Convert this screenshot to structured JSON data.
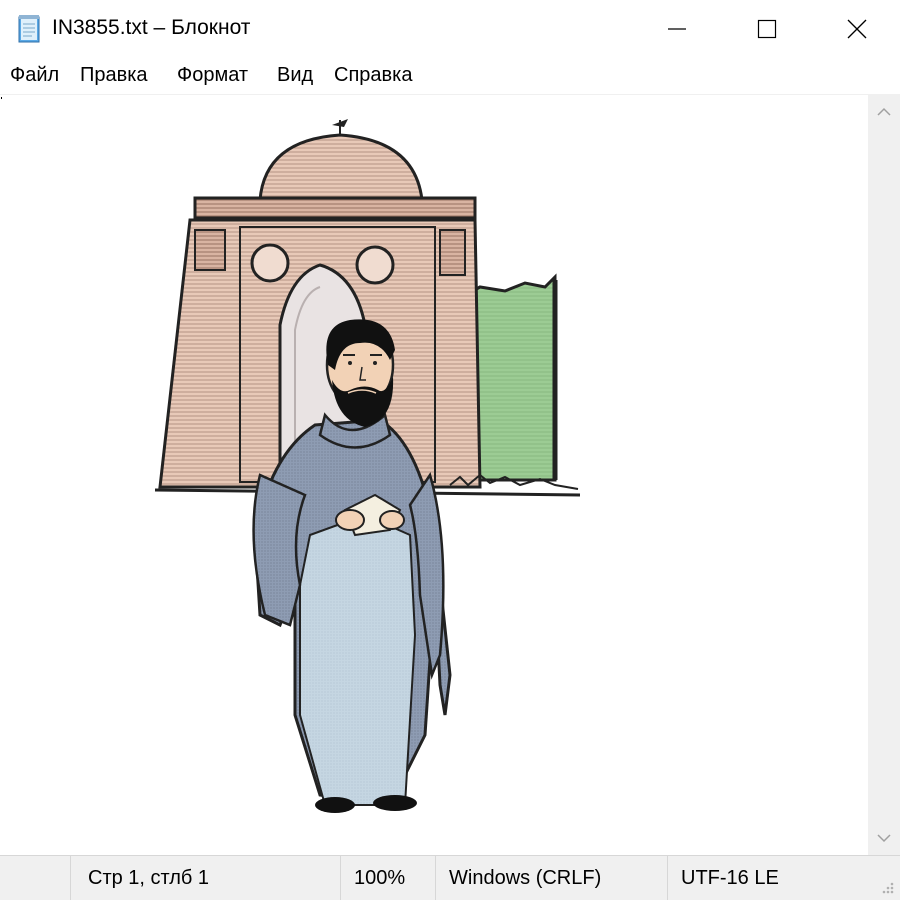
{
  "window": {
    "title": "IN3855.txt – Блокнот",
    "minimize_icon": "minimize-icon",
    "maximize_icon": "maximize-icon",
    "close_icon": "close-icon"
  },
  "menu": {
    "items": [
      {
        "label": "Файл"
      },
      {
        "label": "Правка"
      },
      {
        "label": "Формат"
      },
      {
        "label": "Вид"
      },
      {
        "label": "Справка"
      }
    ]
  },
  "statusbar": {
    "position": "Стр 1, стлб 1",
    "zoom": "100%",
    "line_ending": "Windows (CRLF)",
    "encoding": "UTF-16 LE"
  },
  "colors": {
    "building": "#e8c9b8",
    "building_dark": "#c9a08c",
    "tree": "#9ccc94",
    "robe": "#8e9cb3",
    "robe_light": "#c5d6e2",
    "skin": "#f2d2b6",
    "hair": "#111111"
  }
}
